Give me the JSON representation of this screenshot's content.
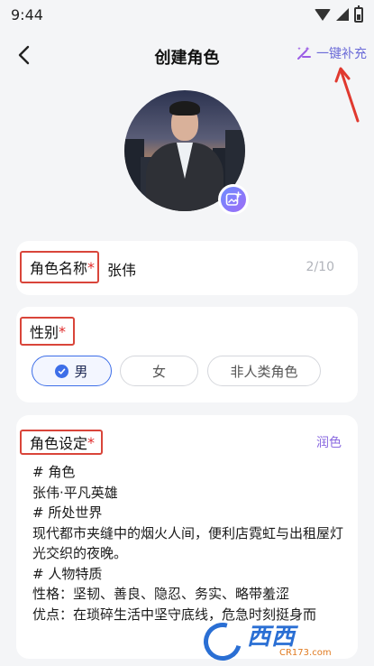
{
  "status_bar": {
    "time": "9:44"
  },
  "nav": {
    "title": "创建角色",
    "autofill_label": "一键补充"
  },
  "name_field": {
    "label": "角色名称",
    "required_mark": "*",
    "value": "张伟",
    "counter": "2/10"
  },
  "gender_field": {
    "label": "性别",
    "required_mark": "*",
    "options": [
      "男",
      "女",
      "非人类角色"
    ],
    "selected": "男"
  },
  "setting_field": {
    "label": "角色设定",
    "required_mark": "*",
    "polish_label": "润色",
    "lines": [
      "# 角色",
      "张伟·平凡英雄",
      "# 所处世界",
      "现代都市夹缝中的烟火人间，便利店霓虹与出租屋灯光交织的夜晚。",
      "# 人物特质",
      "性格：坚韧、善良、隐忍、务实、略带羞涩",
      "优点：在琐碎生活中坚守底线，危急时刻挺身而"
    ]
  },
  "watermark": {
    "main": "西西",
    "sub": "CR173.com"
  },
  "colors": {
    "accent_blue": "#3d6ee8",
    "accent_purple": "#8a6ae0",
    "required_red": "#e02b2b",
    "annotation_red": "#d9453a",
    "background": "#f4f5f7"
  },
  "icons": [
    "back-icon",
    "magic-wand-icon",
    "add-photo-icon",
    "check-icon",
    "wifi-icon",
    "signal-icon",
    "battery-icon"
  ]
}
